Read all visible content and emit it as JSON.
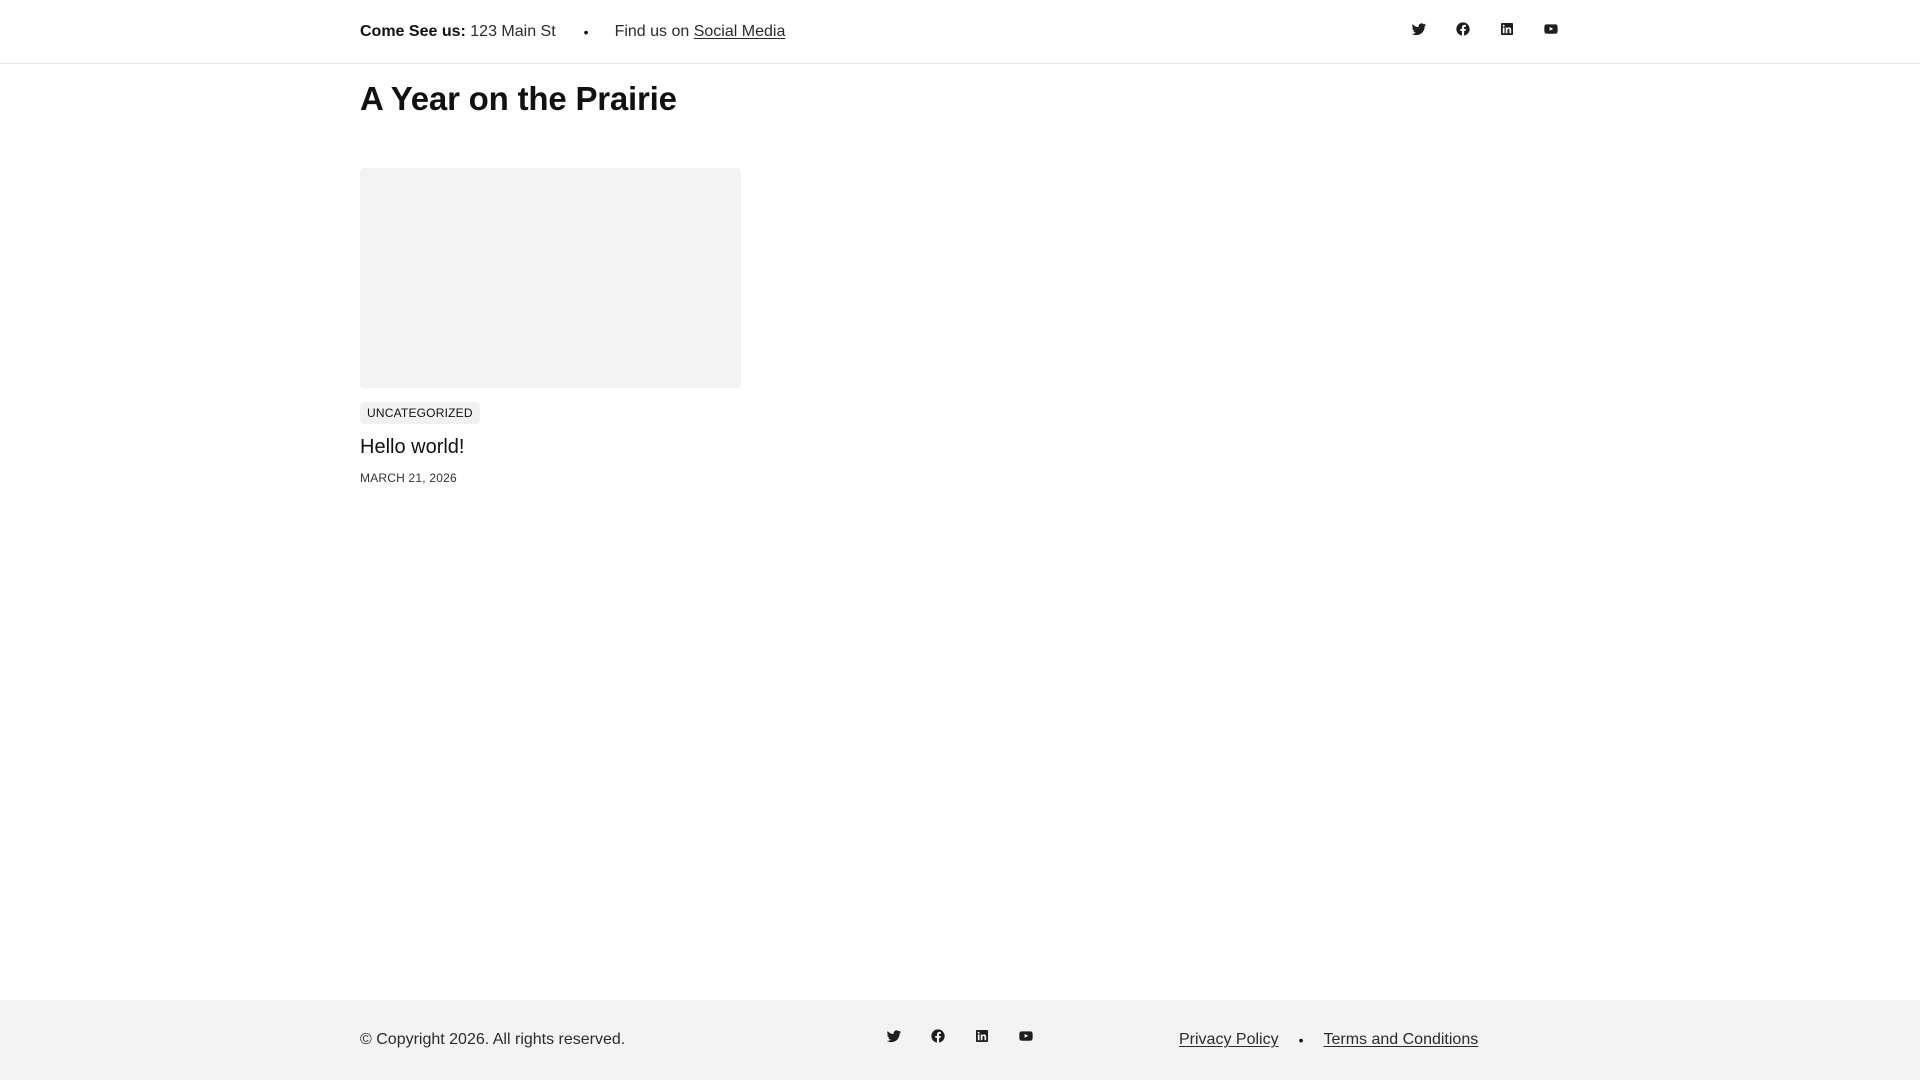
{
  "topbar": {
    "address_label": "Come See us:",
    "address_value": "123 Main St",
    "separator": "•",
    "find_text": "Find us on",
    "social_link": "Social Media",
    "social_icons": [
      "twitter-icon",
      "facebook-icon",
      "linkedin-icon",
      "youtube-icon"
    ]
  },
  "main": {
    "title": "A Year on the Prairie",
    "posts": [
      {
        "category": "UNCATEGORIZED",
        "title": "Hello world!",
        "date": "MARCH 21, 2026"
      }
    ]
  },
  "footer": {
    "copyright": "© Copyright 2026. All rights reserved.",
    "social_icons": [
      "twitter-icon",
      "facebook-icon",
      "linkedin-icon",
      "youtube-icon"
    ],
    "links": [
      "Privacy Policy",
      "Terms and Conditions"
    ],
    "separator": "•"
  },
  "colors": {
    "text": "#111111",
    "footer_bg": "#f3f3f3",
    "thumb_bg": "#f3f3f3",
    "badge_bg": "#f1f1f1"
  }
}
